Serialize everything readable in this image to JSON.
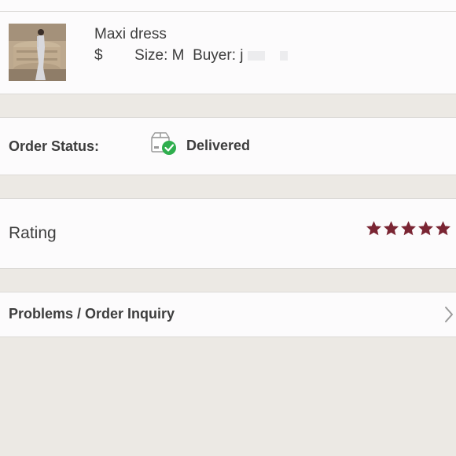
{
  "item": {
    "name": "Maxi dress",
    "price_symbol": "$",
    "size_text": "Size: M",
    "buyer_text": "Buyer: j"
  },
  "order_status": {
    "label": "Order Status:",
    "value": "Delivered",
    "icon": "package-delivered-icon",
    "check_color": "#2fae4e"
  },
  "rating": {
    "label": "Rating",
    "stars": 5,
    "max_stars": 5,
    "star_color": "#7a2533"
  },
  "problems": {
    "label": "Problems / Order Inquiry",
    "icon": "chevron-right-icon"
  }
}
